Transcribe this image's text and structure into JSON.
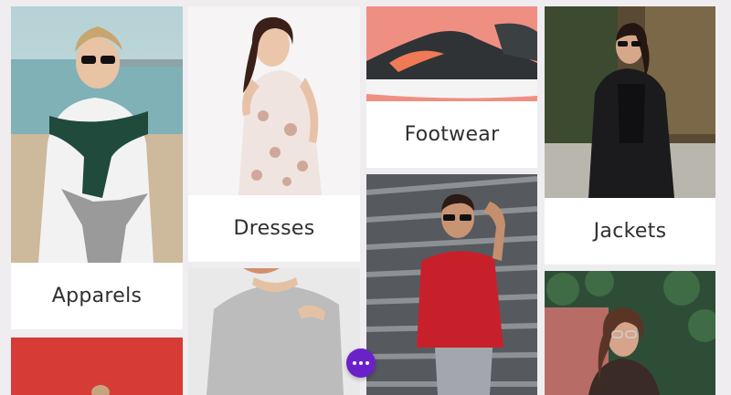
{
  "categories": [
    {
      "label": "Apparels"
    },
    {
      "label": "Dresses"
    },
    {
      "label": "Footwear"
    },
    {
      "label": "Jackets"
    }
  ],
  "colors": {
    "background": "#efedf0",
    "card_label_bg": "#ffffff",
    "label_text": "#2f2f2f",
    "chat_button": "#6b21c8"
  },
  "chat_button": {
    "icon": "more-dots-icon"
  }
}
